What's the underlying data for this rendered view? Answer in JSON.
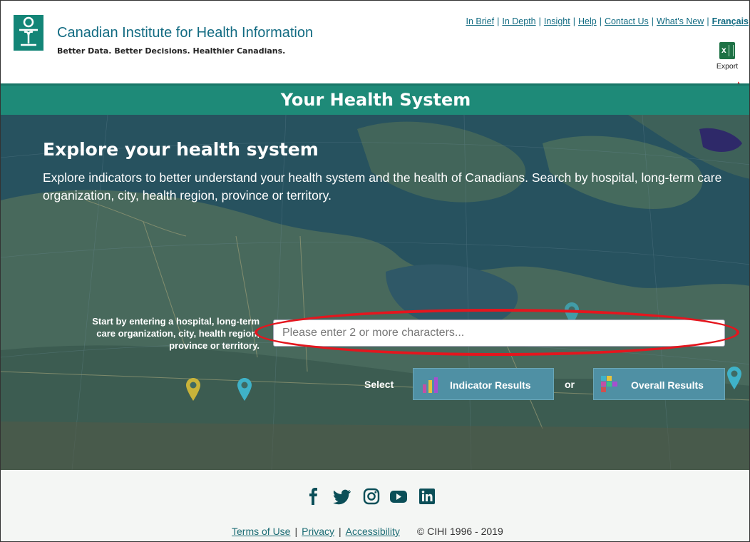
{
  "header": {
    "org_name": "Canadian Institute for Health Information",
    "tagline": "Better Data. Better Decisions. Healthier Canadians.",
    "top_links": [
      {
        "label": "In Brief"
      },
      {
        "label": "In Depth"
      },
      {
        "label": "Insight"
      },
      {
        "label": "Help"
      },
      {
        "label": "Contact Us"
      },
      {
        "label": "What's New"
      },
      {
        "label": "Français"
      }
    ],
    "export_label": "Export"
  },
  "banner": {
    "title": "Your Health System"
  },
  "hero": {
    "heading": "Explore your health system",
    "description": "Explore indicators to better understand your health system and the health of Canadians. Search by hospital, long-term care organization, city, health region, province or territory.",
    "search_label": "Start by entering a hospital, long-term care organization, city, health region, province or territory.",
    "search_placeholder": "Please enter 2 or more characters...",
    "select_label": "Select",
    "or_label": "or",
    "indicator_button": "Indicator Results",
    "overall_button": "Overall Results"
  },
  "footer": {
    "social": [
      "facebook-icon",
      "twitter-icon",
      "instagram-icon",
      "youtube-icon",
      "linkedin-icon"
    ],
    "links": [
      {
        "label": "Terms of Use"
      },
      {
        "label": "Privacy"
      },
      {
        "label": "Accessibility"
      }
    ],
    "copyright": "© CIHI 1996 - 2019"
  },
  "colors": {
    "brand_teal": "#1e8a78",
    "link_blue": "#126b82",
    "button_blue": "#4f90a4",
    "highlight_red": "#e4161e"
  }
}
